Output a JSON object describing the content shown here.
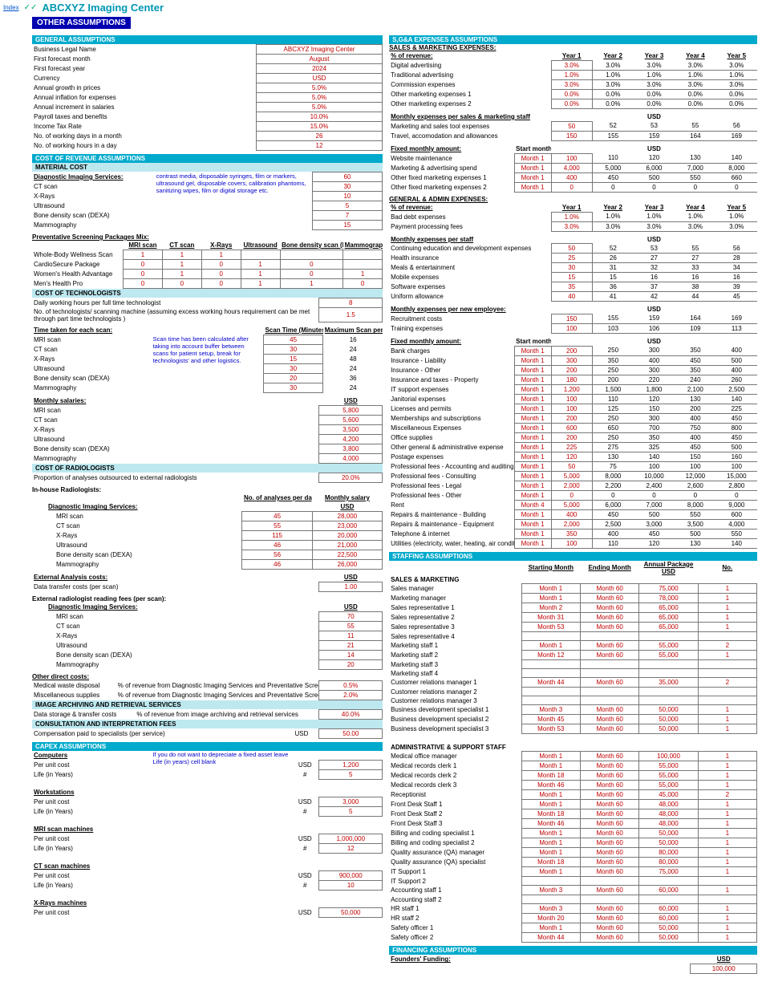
{
  "index": "Index",
  "chk": "✓✓",
  "title": "ABCXYZ Imaging Center",
  "h": "OTHER ASSUMPTIONS",
  "gen": {
    "h": "GENERAL ASSUMPTIONS",
    "rows": [
      [
        "Business Legal Name",
        "ABCXYZ Imaging Center"
      ],
      [
        "First forecast month",
        "August"
      ],
      [
        "First forecast year",
        "2024"
      ],
      [
        "Currency",
        "USD"
      ],
      [
        "Annual growth in prices",
        "5.0%"
      ],
      [
        "Annual inflation for expenses",
        "5.0%"
      ],
      [
        "Annual increment in salaries",
        "5.0%"
      ],
      [
        "Payroll taxes and benefits",
        "10.0%"
      ],
      [
        "Income Tax Rate",
        "15.0%"
      ],
      [
        "No. of working days in a month",
        "26"
      ],
      [
        "No. of working hours in a day",
        "12"
      ]
    ]
  },
  "cor": {
    "h": "COST OF REVENUE ASSUMPTIONS",
    "mat": "MATERIAL COST"
  },
  "dis": {
    "h": "Diagnostic Imaging Services:",
    "note": "contrast media, disposable syringes, film or markers, ultrasound gel, disposable covers, calibration phantoms, sanitizing wipes, film or digital storage etc.",
    "rows": [
      [
        "MRI scan",
        "60"
      ],
      [
        "CT scan",
        "30"
      ],
      [
        "X-Rays",
        "10"
      ],
      [
        "Ultrasound",
        "5"
      ],
      [
        "Bone density scan (DEXA)",
        "7"
      ],
      [
        "Mammography",
        "15"
      ]
    ]
  },
  "psm": {
    "h": "Preventative Screening Packages Mix:",
    "cols": [
      "",
      "MRI scan",
      "CT scan",
      "X-Rays",
      "Ultrasound",
      "Bone density scan (DEXA)",
      "Mammography"
    ],
    "rows": [
      [
        "Whole-Body Wellness Scan",
        "1",
        "1",
        "1",
        "",
        "",
        ""
      ],
      [
        "CardioSecure Package",
        "0",
        "1",
        "0",
        "1",
        "0",
        ""
      ],
      [
        "Women's Health Advantage",
        "0",
        "1",
        "0",
        "1",
        "0",
        "1"
      ],
      [
        "Men's Health Pro",
        "0",
        "0",
        "0",
        "1",
        "1",
        "0"
      ]
    ]
  },
  "cot": {
    "h": "COST OF TECHNOLOGISTS",
    "r1": [
      "Daily working hours per full time technologist",
      "8"
    ],
    "r2": [
      "No. of technologists/ scanning machine (assuming excess working hours requirement can be met through part time technologists )",
      "1.5"
    ]
  },
  "tts": {
    "h": "Time taken for each scan:",
    "c1": "Scan Time (Minutes)",
    "c2": "Maximum Scan per day",
    "note": "Scan time has been calculated after taking into account buffer between scans for patient setup, break for technologists' and other logistics.",
    "rows": [
      [
        "MRI scan",
        "45",
        "16"
      ],
      [
        "CT scan",
        "30",
        "24"
      ],
      [
        "X-Rays",
        "15",
        "48"
      ],
      [
        "Ultrasound",
        "30",
        "24"
      ],
      [
        "Bone density scan (DEXA)",
        "20",
        "36"
      ],
      [
        "Mammography",
        "30",
        "24"
      ]
    ]
  },
  "msal": {
    "h": "Monthly salaries:",
    "u": "USD",
    "rows": [
      [
        "MRI scan",
        "5,800"
      ],
      [
        "CT scan",
        "5,600"
      ],
      [
        "X-Rays",
        "3,500"
      ],
      [
        "Ultrasound",
        "4,200"
      ],
      [
        "Bone density scan (DEXA)",
        "3,800"
      ],
      [
        "Mammography",
        "4,000"
      ]
    ]
  },
  "crad": {
    "h": "COST OF RADIOLOGISTS",
    "r": [
      "Proportion of analyses outsourced to external radiologists",
      "20.0%"
    ],
    "ih": "In-house Radiologists:",
    "c1": "No. of analyses per day",
    "c2": "Monthly salary",
    "u": "USD",
    "rows": [
      [
        "MRI scan",
        "45",
        "28,000"
      ],
      [
        "CT scan",
        "55",
        "23,000"
      ],
      [
        "X-Rays",
        "115",
        "20,000"
      ],
      [
        "Ultrasound",
        "46",
        "21,000"
      ],
      [
        "Bone density scan (DEXA)",
        "56",
        "22,500"
      ],
      [
        "Mammography",
        "46",
        "26,000"
      ]
    ]
  },
  "eac": {
    "h": "External Analysis costs:",
    "u": "USD",
    "r": [
      "Data transfer costs (per scan)",
      "1.00"
    ]
  },
  "erf": {
    "h": "External radiologist reading fees (per scan):",
    "sh": "Diagnostic Imaging Services:",
    "u": "USD",
    "rows": [
      [
        "MRI scan",
        "70"
      ],
      [
        "CT scan",
        "55"
      ],
      [
        "X-Rays",
        "11"
      ],
      [
        "Ultrasound",
        "21"
      ],
      [
        "Bone density scan (DEXA)",
        "14"
      ],
      [
        "Mammography",
        "20"
      ]
    ]
  },
  "odc": {
    "h": "Other direct costs:",
    "rows": [
      [
        "Medical waste disposal",
        "% of revenue from Diagnostic Imaging Services and Preventative Screening Packages",
        "0.5%"
      ],
      [
        "Miscellaneous supplies",
        "% of revenue from Diagnostic Imaging Services and Preventative Screening Packages",
        "2.0%"
      ]
    ]
  },
  "iar": {
    "h": "IMAGE ARCHIVING AND RETRIEVAL SERVICES",
    "r": [
      "Data storage & transfer costs",
      "% of revenue from image archiving and retrieval services",
      "40.0%"
    ]
  },
  "cif": {
    "h": "CONSULTATION AND INTERPRETATION FEES",
    "r": [
      "Compensation paid to specialists (per service)",
      "USD",
      "50.00"
    ]
  },
  "cap": {
    "h": "CAPEX ASSUMPTIONS",
    "note": "If you do not want to depreciate a fixed asset leave Life (in years) cell blank",
    "items": [
      {
        "n": "Computers",
        "rows": [
          [
            "Per unit cost",
            "USD",
            "1,200"
          ],
          [
            "Life (in Years)",
            "#",
            "5"
          ]
        ]
      },
      {
        "n": "Workstations",
        "rows": [
          [
            "Per unit cost",
            "USD",
            "3,000"
          ],
          [
            "Life (in Years)",
            "#",
            "5"
          ]
        ]
      },
      {
        "n": "MRI scan machines",
        "rows": [
          [
            "Per unit cost",
            "USD",
            "1,000,000"
          ],
          [
            "Life (in Years)",
            "#",
            "12"
          ]
        ]
      },
      {
        "n": "CT scan machines",
        "rows": [
          [
            "Per unit cost",
            "USD",
            "900,000"
          ],
          [
            "Life (in Years)",
            "#",
            "10"
          ]
        ]
      },
      {
        "n": "X-Rays machines",
        "rows": [
          [
            "Per unit cost",
            "USD",
            "50,000"
          ]
        ]
      }
    ]
  },
  "sga": {
    "h": "S,G&A EXPENSES ASSUMPTIONS"
  },
  "sme": {
    "h": "SALES & MARKETING EXPENSES:",
    "pr": {
      "h": "% of revenue:",
      "yc": [
        "Year 1",
        "Year 2",
        "Year 3",
        "Year 4",
        "Year 5"
      ],
      "rows": [
        [
          "Digital advertising",
          "3.0%",
          "3.0%",
          "3.0%",
          "3.0%",
          "3.0%"
        ],
        [
          "Traditional advertising",
          "1.0%",
          "1.0%",
          "1.0%",
          "1.0%",
          "1.0%"
        ],
        [
          "Commission expenses",
          "3.0%",
          "3.0%",
          "3.0%",
          "3.0%",
          "3.0%"
        ],
        [
          "Other marketing expenses 1",
          "0.0%",
          "0.0%",
          "0.0%",
          "0.0%",
          "0.0%"
        ],
        [
          "Other marketing expenses 2",
          "0.0%",
          "0.0%",
          "0.0%",
          "0.0%",
          "0.0%"
        ]
      ]
    },
    "ms": {
      "h": "Monthly expenses per sales & marketing staff",
      "u": "USD",
      "rows": [
        [
          "Marketing and sales tool expenses",
          "50",
          "52",
          "53",
          "55",
          "56"
        ],
        [
          "Travel, accomodation and allowances",
          "150",
          "155",
          "159",
          "164",
          "169"
        ]
      ]
    },
    "fm": {
      "h": "Fixed monthly amount:",
      "sm": "Start month",
      "u": "USD",
      "rows": [
        [
          "Website maintenance",
          "Month 1",
          "100",
          "110",
          "120",
          "130",
          "140"
        ],
        [
          "Marketing & advertising spend",
          "Month 1",
          "4,000",
          "5,000",
          "6,000",
          "7,000",
          "8,000"
        ],
        [
          "Other fixed marketing expenses 1",
          "Month 1",
          "400",
          "450",
          "500",
          "550",
          "660"
        ],
        [
          "Other fixed marketing expenses 2",
          "Month 1",
          "0",
          "0",
          "0",
          "0",
          "0"
        ]
      ]
    }
  },
  "gae": {
    "h": "GENERAL & ADMIN EXPENSES:",
    "pr": {
      "h": "% of revenue:",
      "yc": [
        "Year 1",
        "Year 2",
        "Year 3",
        "Year 4",
        "Year 5"
      ],
      "rows": [
        [
          "Bad debt expenses",
          "1.0%",
          "1.0%",
          "1.0%",
          "1.0%",
          "1.0%"
        ],
        [
          "Payment processing fees",
          "3.0%",
          "3.0%",
          "3.0%",
          "3.0%",
          "3.0%"
        ]
      ]
    },
    "ms": {
      "h": "Monthly expenses per staff",
      "u": "USD",
      "rows": [
        [
          "Continuing education and development expenses",
          "50",
          "52",
          "53",
          "55",
          "56"
        ],
        [
          "Health insurance",
          "25",
          "26",
          "27",
          "27",
          "28"
        ],
        [
          "Meals & entertainment",
          "30",
          "31",
          "32",
          "33",
          "34"
        ],
        [
          "Mobile expenses",
          "15",
          "15",
          "16",
          "16",
          "16"
        ],
        [
          "Software expenses",
          "35",
          "36",
          "37",
          "38",
          "39"
        ],
        [
          "Uniform allowance",
          "40",
          "41",
          "42",
          "44",
          "45"
        ]
      ]
    },
    "ne": {
      "h": "Monthly expenses per new employee:",
      "u": "USD",
      "rows": [
        [
          "Recruitment costs",
          "150",
          "155",
          "159",
          "164",
          "169"
        ],
        [
          "Training expenses",
          "100",
          "103",
          "106",
          "109",
          "113"
        ]
      ]
    },
    "fm": {
      "h": "Fixed monthly amount:",
      "sm": "Start month",
      "u": "USD",
      "rows": [
        [
          "Bank charges",
          "Month 1",
          "200",
          "250",
          "300",
          "350",
          "400"
        ],
        [
          "Insurance - Liability",
          "Month 1",
          "300",
          "350",
          "400",
          "450",
          "500"
        ],
        [
          "Insurance - Other",
          "Month 1",
          "200",
          "250",
          "300",
          "350",
          "400"
        ],
        [
          "Insurance and taxes - Property",
          "Month 1",
          "180",
          "200",
          "220",
          "240",
          "260"
        ],
        [
          "IT support expenses",
          "Month 1",
          "1,200",
          "1,500",
          "1,800",
          "2,100",
          "2,500"
        ],
        [
          "Janitorial expenses",
          "Month 1",
          "100",
          "110",
          "120",
          "130",
          "140"
        ],
        [
          "Licenses and permits",
          "Month 1",
          "100",
          "125",
          "150",
          "200",
          "225"
        ],
        [
          "Memberships and subscriptions",
          "Month 1",
          "200",
          "250",
          "300",
          "400",
          "450"
        ],
        [
          "Miscellaneous Expenses",
          "Month 1",
          "600",
          "650",
          "700",
          "750",
          "800"
        ],
        [
          "Office supplies",
          "Month 1",
          "200",
          "250",
          "350",
          "400",
          "450"
        ],
        [
          "Other general & administrative expense",
          "Month 1",
          "225",
          "275",
          "325",
          "450",
          "500"
        ],
        [
          "Postage expenses",
          "Month 1",
          "120",
          "130",
          "140",
          "150",
          "160"
        ],
        [
          "Professional fees - Accounting and auditing",
          "Month 1",
          "50",
          "75",
          "100",
          "100",
          "100"
        ],
        [
          "Professional fees - Consulting",
          "Month 1",
          "5,000",
          "8,000",
          "10,000",
          "12,000",
          "15,000"
        ],
        [
          "Professional fees - Legal",
          "Month 1",
          "2,000",
          "2,200",
          "2,400",
          "2,600",
          "2,800"
        ],
        [
          "Professional fees - Other",
          "Month 1",
          "0",
          "0",
          "0",
          "0",
          "0"
        ],
        [
          "Rent",
          "Month 4",
          "5,000",
          "6,000",
          "7,000",
          "8,000",
          "9,000"
        ],
        [
          "Repairs & maintenance - Building",
          "Month 1",
          "400",
          "450",
          "500",
          "550",
          "600"
        ],
        [
          "Repairs & maintenance - Equipment",
          "Month 1",
          "2,000",
          "2,500",
          "3,000",
          "3,500",
          "4,000"
        ],
        [
          "Telephone & internet",
          "Month 1",
          "350",
          "400",
          "450",
          "500",
          "550"
        ],
        [
          "Utilities (electricity, water, heating, air conditioning)",
          "Month 1",
          "100",
          "110",
          "120",
          "130",
          "140"
        ]
      ]
    }
  },
  "staff": {
    "h": "STAFFING ASSUMPTIONS",
    "cols": [
      "Starting Month",
      "Ending Month",
      "Annual Package USD",
      "No."
    ],
    "g1": {
      "h": "SALES & MARKETING",
      "rows": [
        [
          "Sales manager",
          "Month 1",
          "Month 60",
          "75,000",
          "1"
        ],
        [
          "Marketing manager",
          "Month 1",
          "Month 60",
          "78,000",
          "1"
        ],
        [
          "Sales representative 1",
          "Month 2",
          "Month 60",
          "65,000",
          "1"
        ],
        [
          "Sales representative 2",
          "Month 31",
          "Month 60",
          "65,000",
          "1"
        ],
        [
          "Sales representative 3",
          "Month 53",
          "Month 60",
          "65,000",
          "1"
        ],
        [
          "Sales representative 4",
          "",
          "",
          "",
          ""
        ],
        [
          "Marketing staff 1",
          "Month 1",
          "Month 60",
          "55,000",
          "2"
        ],
        [
          "Marketing staff 2",
          "Month 12",
          "Month 60",
          "55,000",
          "1"
        ],
        [
          "Marketing staff 3",
          "",
          "",
          "",
          ""
        ],
        [
          "Marketing staff 4",
          "",
          "",
          "",
          ""
        ],
        [
          "Customer relations manager 1",
          "Month 44",
          "Month 60",
          "35,000",
          "2"
        ],
        [
          "Customer relations manager 2",
          "",
          "",
          "",
          ""
        ],
        [
          "Customer relations manager 3",
          "",
          "",
          "",
          ""
        ],
        [
          "Business development specialist 1",
          "Month 3",
          "Month 60",
          "50,000",
          "1"
        ],
        [
          "Business development specialist 2",
          "Month 45",
          "Month 60",
          "50,000",
          "1"
        ],
        [
          "Business development specialist 3",
          "Month 53",
          "Month 60",
          "50,000",
          "1"
        ]
      ]
    },
    "g2": {
      "h": "ADMINISTRATIVE & SUPPORT STAFF",
      "rows": [
        [
          "Medical office manager",
          "Month 1",
          "Month 60",
          "100,000",
          "1"
        ],
        [
          "Medical records clerk 1",
          "Month 1",
          "Month 60",
          "55,000",
          "1"
        ],
        [
          "Medical records clerk 2",
          "Month 18",
          "Month 60",
          "55,000",
          "1"
        ],
        [
          "Medical records clerk 3",
          "Month 46",
          "Month 60",
          "55,000",
          "1"
        ],
        [
          "Receptionist",
          "Month 1",
          "Month 60",
          "45,000",
          "2"
        ],
        [
          "Front Desk Staff 1",
          "Month 1",
          "Month 60",
          "48,000",
          "1"
        ],
        [
          "Front Desk Staff 2",
          "Month 18",
          "Month 60",
          "48,000",
          "1"
        ],
        [
          "Front Desk Staff 3",
          "Month 46",
          "Month 60",
          "48,000",
          "1"
        ],
        [
          "Billing and coding specialist 1",
          "Month 1",
          "Month 60",
          "50,000",
          "1"
        ],
        [
          "Billing and coding specialist 2",
          "Month 1",
          "Month 60",
          "50,000",
          "1"
        ],
        [
          "Quality assurance (QA) manager",
          "Month 1",
          "Month 60",
          "80,000",
          "1"
        ],
        [
          "Quality assurance (QA) specialist",
          "Month 18",
          "Month 60",
          "80,000",
          "1"
        ],
        [
          "IT Support 1",
          "Month 1",
          "Month 60",
          "75,000",
          "1"
        ],
        [
          "IT Support 2",
          "",
          "",
          "",
          ""
        ],
        [
          "Accounting staff 1",
          "Month 3",
          "Month 60",
          "60,000",
          "1"
        ],
        [
          "Accounting staff 2",
          "",
          "",
          "",
          ""
        ],
        [
          "HR staff 1",
          "Month 3",
          "Month 60",
          "60,000",
          "1"
        ],
        [
          "HR staff 2",
          "Month 20",
          "Month 60",
          "60,000",
          "1"
        ],
        [
          "Safety officer 1",
          "Month 1",
          "Month 60",
          "50,000",
          "1"
        ],
        [
          "Safety officer 2",
          "Month 44",
          "Month 60",
          "50,000",
          "1"
        ]
      ]
    }
  },
  "fin": {
    "h": "FINANCING ASSUMPTIONS",
    "sh": "Founders' Funding:",
    "u": "USD",
    "v": "100,000"
  }
}
